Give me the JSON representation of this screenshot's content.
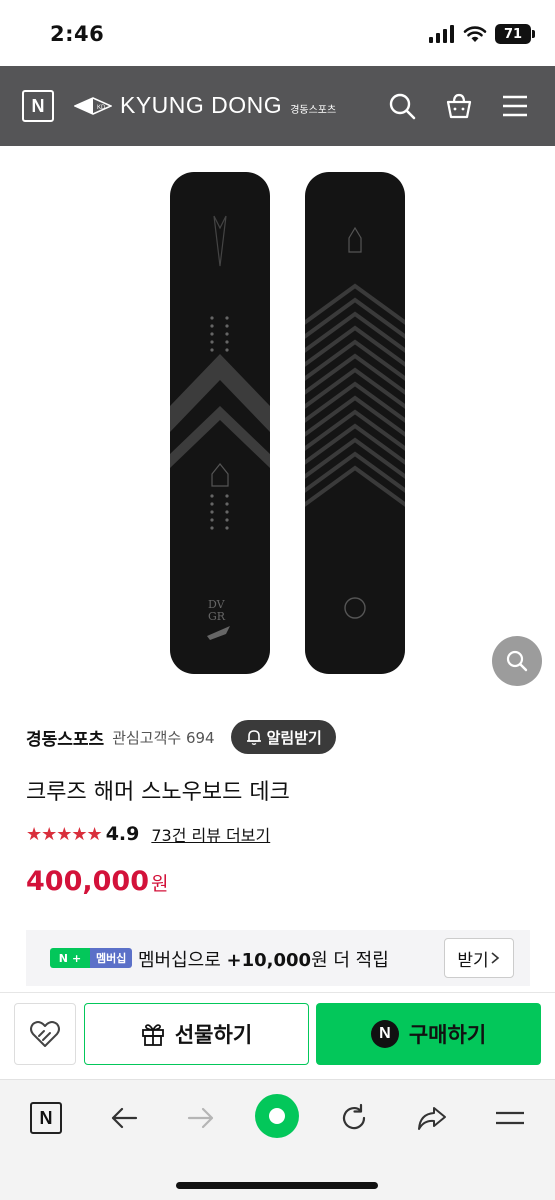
{
  "status_bar": {
    "time": "2:46",
    "battery": "71"
  },
  "header": {
    "logo_letter": "N",
    "brand_mark": "KD",
    "brand_name": "KYUNG DONG",
    "brand_sub": "경동스포츠"
  },
  "store": {
    "name": "경동스포츠",
    "interest_label": "관심고객수 694",
    "notify_label": "알림받기"
  },
  "product": {
    "title": "크루즈 해머 스노우보드 데크",
    "stars": "★★★★★",
    "rating": "4.9",
    "review_link": "73건 리뷰 더보기",
    "price": "400,000",
    "currency": "원",
    "board_text": [
      "DV",
      "GR"
    ]
  },
  "membership": {
    "badge_n": "N",
    "badge_plus": "+",
    "badge_label": "멤버십",
    "text_prefix": "멤버십으로 ",
    "text_amount": "+10,000",
    "text_suffix": "원 더 적립",
    "claim_label": "받기"
  },
  "actions": {
    "gift_label": "선물하기",
    "buy_logo": "N",
    "buy_label": "구매하기"
  },
  "browser": {
    "logo_letter": "N"
  },
  "colors": {
    "naver_green": "#03c75a",
    "price_red": "#d3123a",
    "star_red": "#d92e3b",
    "header_gray": "#555557"
  }
}
